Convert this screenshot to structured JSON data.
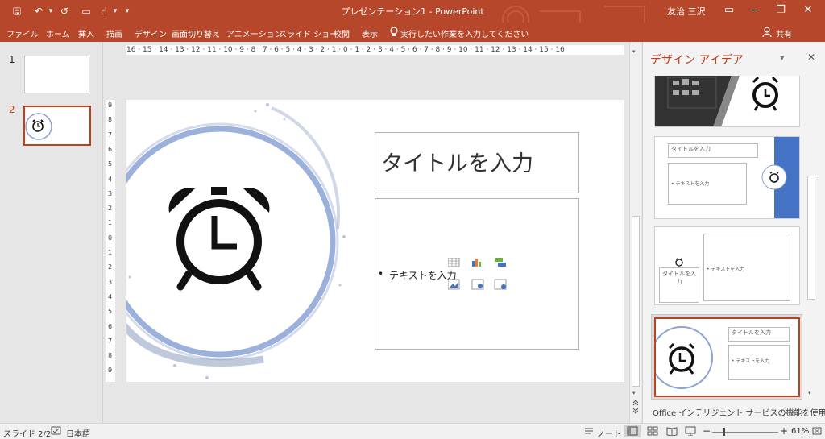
{
  "window": {
    "title": "プレゼンテーション1  -  PowerPoint",
    "user": "友治 三沢"
  },
  "quick_access": {
    "save": "🖫",
    "undo": "↶",
    "redo": "↺",
    "present": "▭",
    "touch": "☝",
    "customize": "▾"
  },
  "window_controls": {
    "ribbon_display": "▭",
    "minimize": "—",
    "restore": "❐",
    "close": "✕"
  },
  "menu": {
    "tabs": [
      "ファイル",
      "ホーム",
      "挿入",
      "描画",
      "デザイン",
      "画面切り替え",
      "アニメーション",
      "スライド ショー",
      "校閲",
      "表示"
    ],
    "tell_me": "実行したい作業を入力してください",
    "share": "共有"
  },
  "thumbnails": [
    {
      "number": "1"
    },
    {
      "number": "2"
    }
  ],
  "ruler": {
    "horizontal": "16 · 15 · 14 · 13 · 12 · 11 · 10 · 9 · 8 · 7 · 6 · 5 · 4 · 3 · 2 · 1 · 0 · 1 · 2 · 3 · 4 · 5 · 6 · 7 · 8 · 9 · 10 · 11 · 12 · 13 · 14 · 15 · 16",
    "vertical": [
      "9",
      "8",
      "7",
      "6",
      "5",
      "4",
      "3",
      "2",
      "1",
      "0",
      "1",
      "2",
      "3",
      "4",
      "5",
      "6",
      "7",
      "8",
      "9"
    ]
  },
  "slide": {
    "title_placeholder": "タイトルを入力",
    "body_bullet": "•",
    "body_placeholder": "テキストを入力",
    "accent_color": "#8aa2d4"
  },
  "design_panel": {
    "title": "デザイン アイデア",
    "dropdown": "▾",
    "close": "✕",
    "card_title_text": "タイトルを入力",
    "card_body_text": "• テキストを入力",
    "card3_title": "タイトルを入力",
    "footer": "Office インテリジェント サービスの機能を使用",
    "accent_color": "#4472c4",
    "selected_color": "#c43e1c"
  },
  "status": {
    "slide_indicator": "スライド 2/2",
    "language": "日本語",
    "notes": "ノート",
    "zoom": "61%",
    "zoom_fraction": 0.61
  },
  "colors": {
    "ribbon": "#b7472a"
  }
}
